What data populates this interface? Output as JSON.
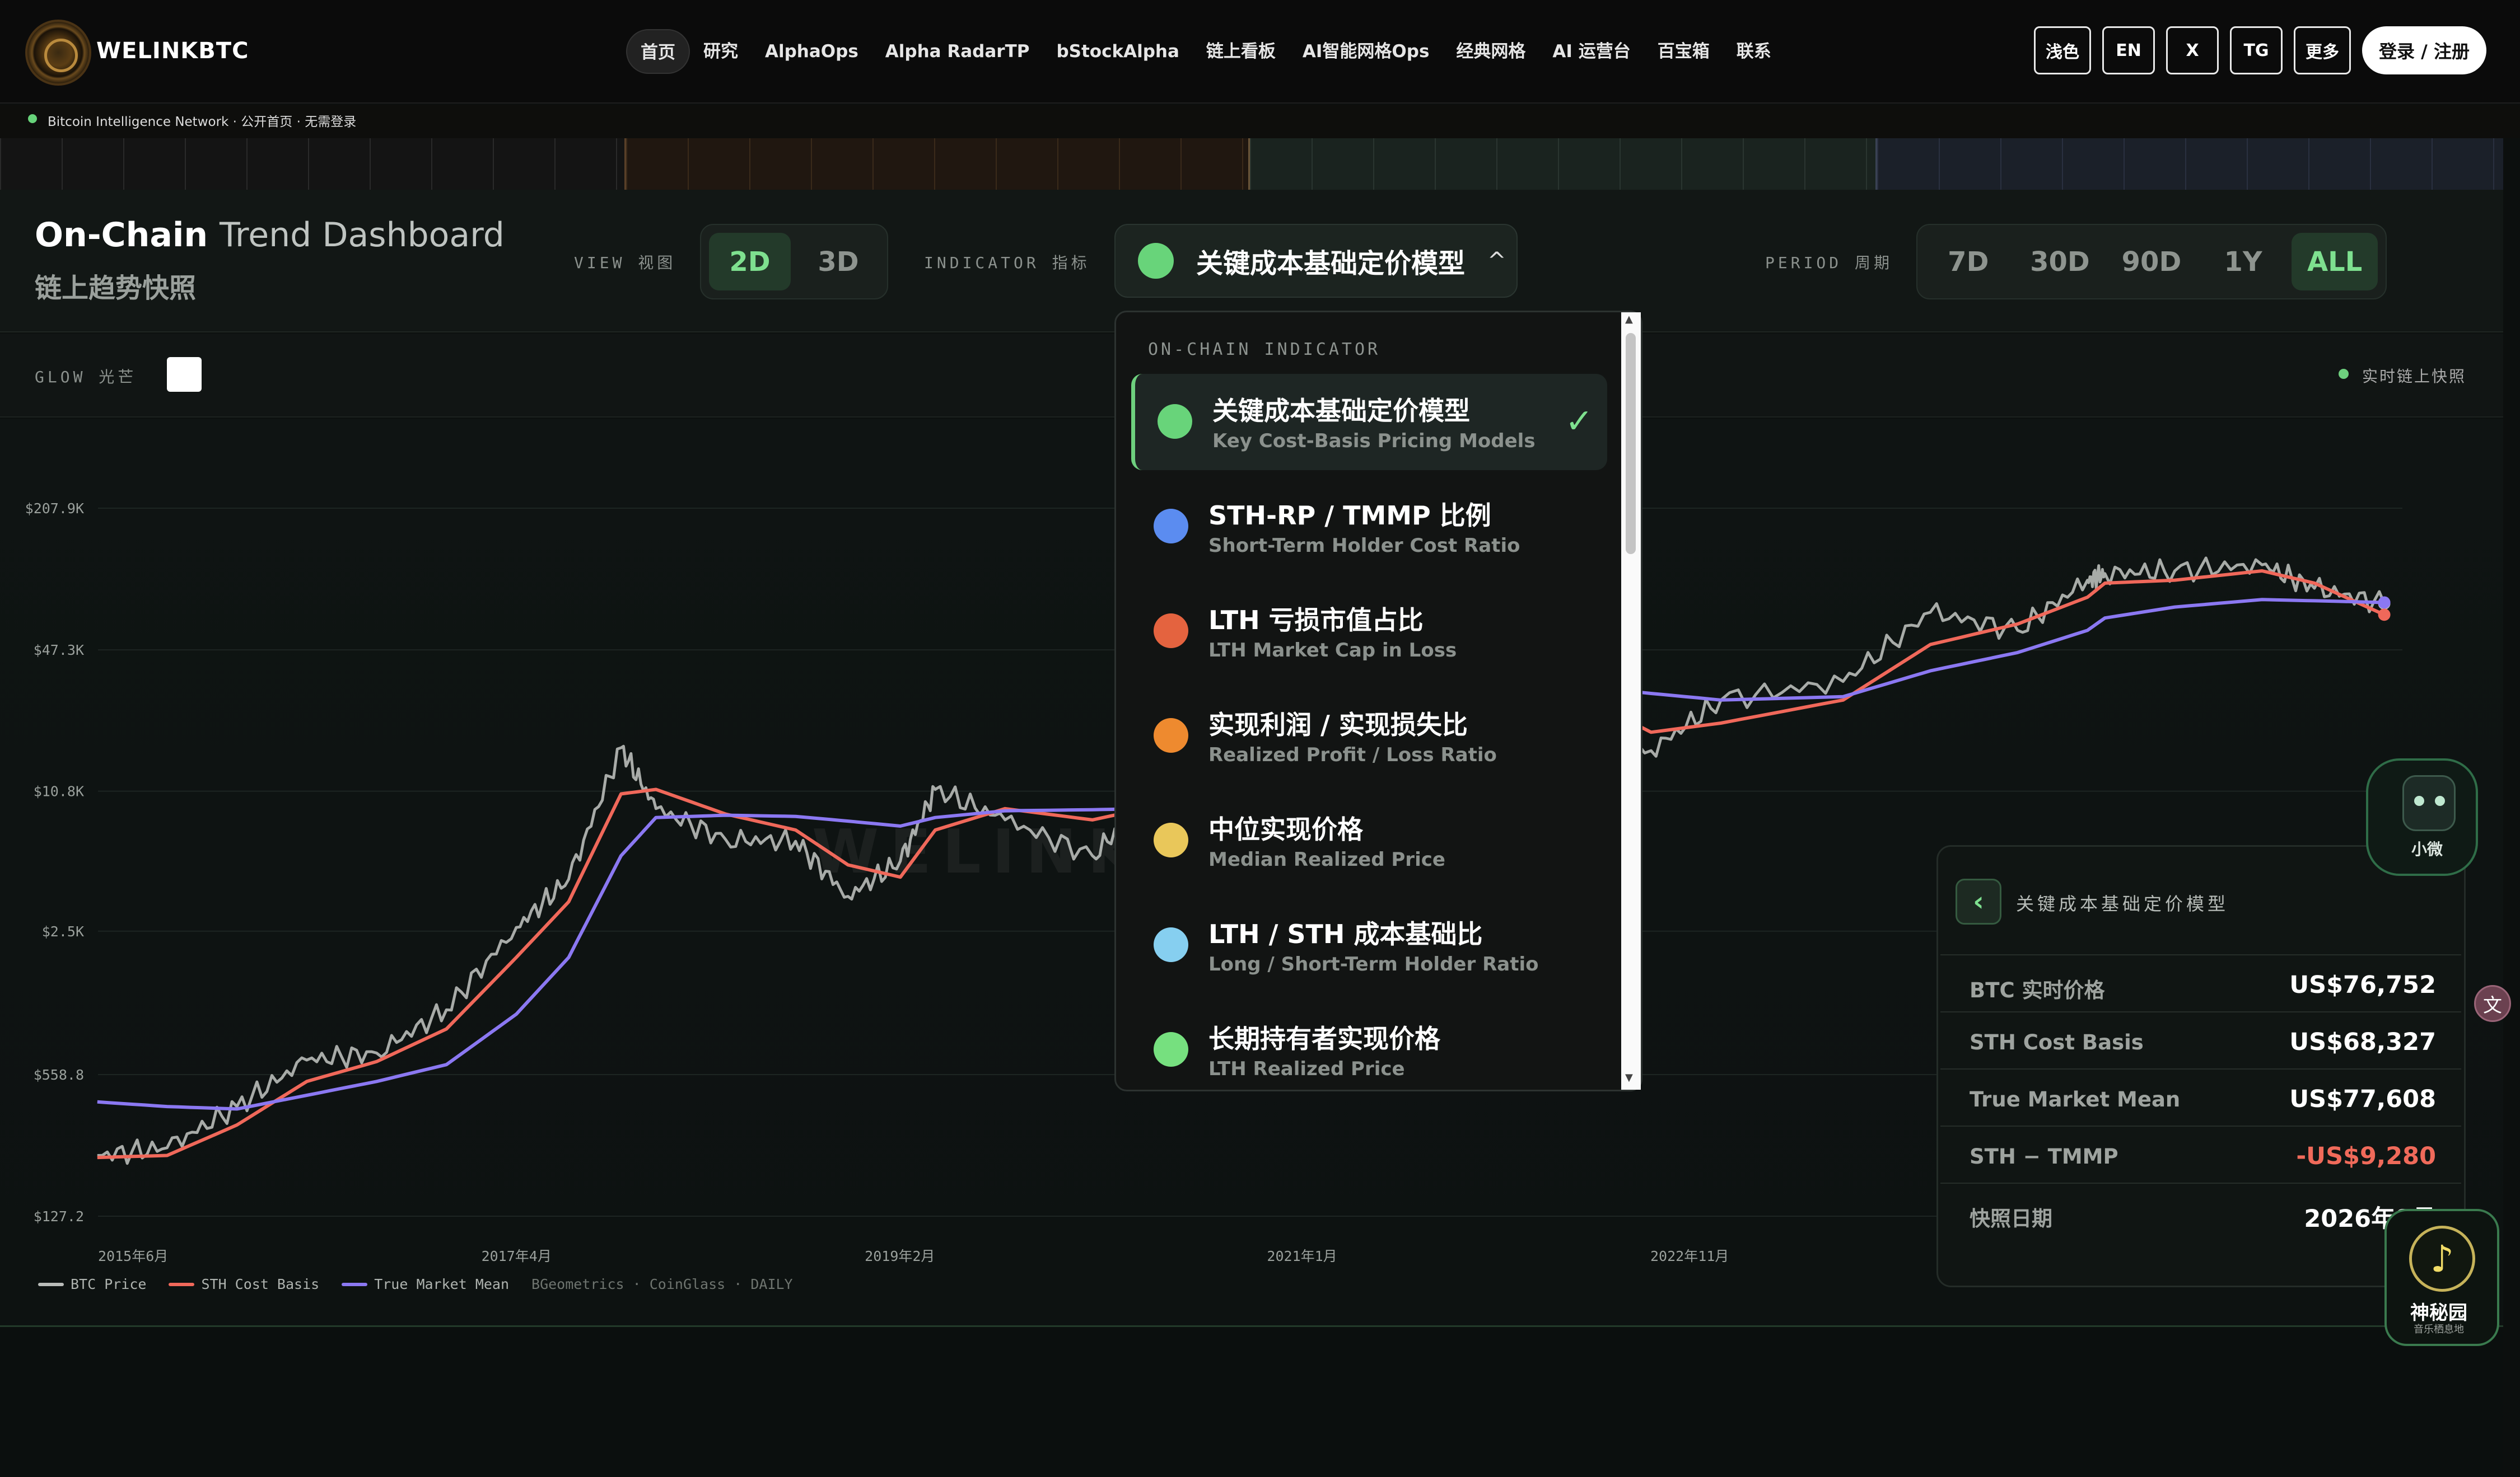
{
  "brand": {
    "name": "WELINKBTC"
  },
  "nav": {
    "links": [
      "首页",
      "研究",
      "AlphaOps",
      "Alpha RadarTP",
      "bStockAlpha",
      "链上看板",
      "AI智能网格Ops",
      "经典网格",
      "AI 运营台",
      "百宝箱",
      "联系"
    ],
    "active_index": 0,
    "right_buttons": [
      "浅色",
      "EN",
      "X",
      "TG",
      "更多"
    ],
    "login_label": "登录 / 注册"
  },
  "status": {
    "text": "Bitcoin Intelligence Network · 公开首页 · 无需登录",
    "dot_color": "#67d37a"
  },
  "dashboard": {
    "title_main": "On-Chain",
    "title_rest": "Trend Dashboard",
    "title_zh": "链上趋势快照",
    "view_label": "VIEW 视图",
    "view_options": [
      "2D",
      "3D"
    ],
    "view_selected": "2D",
    "indicator_label": "INDICATOR 指标",
    "indicator_selected": "关键成本基础定价模型",
    "indicator_caret": "^",
    "period_label": "PERIOD 周期",
    "period_options": [
      "7D",
      "30D",
      "90D",
      "1Y",
      "ALL"
    ],
    "period_selected": "ALL",
    "glow_label": "GLOW 光芒",
    "live_label": "实时链上快照"
  },
  "dropdown": {
    "header": "ON-CHAIN INDICATOR",
    "items": [
      {
        "zh": "关键成本基础定价模型",
        "en": "Key Cost-Basis Pricing Models",
        "color": "#68d47a",
        "selected": true
      },
      {
        "zh": "STH-RP / TMMP 比例",
        "en": "Short-Term Holder Cost Ratio",
        "color": "#5b8cf0"
      },
      {
        "zh": "LTH 亏损市值占比",
        "en": "LTH Market Cap in Loss",
        "color": "#e4633f"
      },
      {
        "zh": "实现利润 / 实现损失比",
        "en": "Realized Profit / Loss Ratio",
        "color": "#ee8a2f"
      },
      {
        "zh": "中位实现价格",
        "en": "Median Realized Price",
        "color": "#e9c75a"
      },
      {
        "zh": "LTH / STH 成本基础比",
        "en": "Long / Short-Term Holder Ratio",
        "color": "#86cff0"
      },
      {
        "zh": "长期持有者实现价格",
        "en": "LTH Realized Price",
        "color": "#76e07f"
      }
    ],
    "check": "✓"
  },
  "chart_data": {
    "type": "line",
    "y_scale": "log",
    "y_ticks": [
      "$207.9K",
      "$47.3K",
      "$10.8K",
      "$2.5K",
      "$558.8",
      "$127.2"
    ],
    "y_tick_values": [
      207900,
      47300,
      10800,
      2500,
      558.8,
      127.2
    ],
    "x_ticks": [
      "2015年6月",
      "2017年4月",
      "2019年2月",
      "2021年1月",
      "2022年11月"
    ],
    "series": [
      {
        "name": "BTC Price",
        "color": "#b9bcb9",
        "points": [
          [
            "2015-06",
            240
          ],
          [
            "2015-10",
            260
          ],
          [
            "2016-02",
            400
          ],
          [
            "2016-06",
            650
          ],
          [
            "2016-10",
            700
          ],
          [
            "2017-02",
            1100
          ],
          [
            "2017-06",
            2600
          ],
          [
            "2017-09",
            4300
          ],
          [
            "2017-12",
            17000
          ],
          [
            "2018-02",
            9000
          ],
          [
            "2018-06",
            6500
          ],
          [
            "2018-10",
            6400
          ],
          [
            "2019-01",
            3600
          ],
          [
            "2019-04",
            5200
          ],
          [
            "2019-06",
            11000
          ],
          [
            "2019-10",
            8000
          ],
          [
            "2020-03",
            5500
          ],
          [
            "2020-06",
            9500
          ],
          [
            "2020-10",
            12500
          ],
          [
            "2021-01",
            35000
          ],
          [
            "2021-04",
            58000
          ],
          [
            "2021-07",
            33000
          ],
          [
            "2021-11",
            66000
          ],
          [
            "2022-06",
            20000
          ],
          [
            "2022-11",
            16500
          ],
          [
            "2023-03",
            28000
          ],
          [
            "2023-10",
            34000
          ],
          [
            "2024-03",
            70000
          ],
          [
            "2024-08",
            58000
          ],
          [
            "2024-12",
            98000
          ],
          [
            "2025-01",
            105000
          ],
          [
            "2025-05",
            108000
          ],
          [
            "2025-10",
            115000
          ],
          [
            "2026-01",
            90000
          ],
          [
            "2026-05",
            76752
          ]
        ]
      },
      {
        "name": "STH Cost Basis",
        "color": "#f0685a",
        "points": [
          [
            "2015-06",
            235
          ],
          [
            "2015-10",
            240
          ],
          [
            "2016-02",
            330
          ],
          [
            "2016-06",
            520
          ],
          [
            "2016-10",
            640
          ],
          [
            "2017-02",
            900
          ],
          [
            "2017-06",
            1900
          ],
          [
            "2017-09",
            3400
          ],
          [
            "2017-12",
            10500
          ],
          [
            "2018-02",
            11000
          ],
          [
            "2018-06",
            8500
          ],
          [
            "2018-10",
            7200
          ],
          [
            "2019-01",
            5000
          ],
          [
            "2019-04",
            4400
          ],
          [
            "2019-06",
            7200
          ],
          [
            "2019-10",
            9000
          ],
          [
            "2020-03",
            8000
          ],
          [
            "2020-06",
            9000
          ],
          [
            "2020-10",
            10500
          ],
          [
            "2021-01",
            20000
          ],
          [
            "2021-04",
            45000
          ],
          [
            "2021-07",
            42000
          ],
          [
            "2021-11",
            55000
          ],
          [
            "2022-06",
            32000
          ],
          [
            "2022-11",
            20000
          ],
          [
            "2023-03",
            22000
          ],
          [
            "2023-10",
            28000
          ],
          [
            "2024-03",
            50000
          ],
          [
            "2024-08",
            62000
          ],
          [
            "2024-12",
            82000
          ],
          [
            "2025-01",
            95000
          ],
          [
            "2025-05",
            98000
          ],
          [
            "2025-10",
            108000
          ],
          [
            "2026-01",
            95000
          ],
          [
            "2026-05",
            68327
          ]
        ]
      },
      {
        "name": "True Market Mean",
        "color": "#8b78f2",
        "points": [
          [
            "2015-06",
            420
          ],
          [
            "2015-10",
            400
          ],
          [
            "2016-02",
            390
          ],
          [
            "2016-06",
            450
          ],
          [
            "2016-10",
            520
          ],
          [
            "2017-02",
            620
          ],
          [
            "2017-06",
            1050
          ],
          [
            "2017-09",
            1900
          ],
          [
            "2017-12",
            5500
          ],
          [
            "2018-02",
            8200
          ],
          [
            "2018-06",
            8400
          ],
          [
            "2018-10",
            8300
          ],
          [
            "2019-01",
            7900
          ],
          [
            "2019-04",
            7500
          ],
          [
            "2019-06",
            8200
          ],
          [
            "2019-10",
            8800
          ],
          [
            "2020-03",
            8900
          ],
          [
            "2020-06",
            9000
          ],
          [
            "2020-10",
            9400
          ],
          [
            "2021-01",
            13000
          ],
          [
            "2021-04",
            22000
          ],
          [
            "2021-07",
            26000
          ],
          [
            "2021-11",
            33000
          ],
          [
            "2022-06",
            33000
          ],
          [
            "2022-11",
            30000
          ],
          [
            "2023-03",
            28000
          ],
          [
            "2023-10",
            29000
          ],
          [
            "2024-03",
            38000
          ],
          [
            "2024-08",
            46000
          ],
          [
            "2024-12",
            58000
          ],
          [
            "2025-01",
            66000
          ],
          [
            "2025-05",
            74000
          ],
          [
            "2025-10",
            80000
          ],
          [
            "2026-01",
            79000
          ],
          [
            "2026-05",
            77608
          ]
        ]
      }
    ],
    "legend": [
      "BTC Price",
      "STH Cost Basis",
      "True Market Mean"
    ],
    "source": "BGeometrics · CoinGlass · DAILY",
    "grid": true,
    "legend_placement": "bottom-left"
  },
  "watermark": "WELINKCHAIN",
  "info_panel": {
    "title": "关键成本基础定价模型",
    "back_icon": "‹",
    "rows": [
      {
        "k": "BTC 实时价格",
        "v": "US$76,752"
      },
      {
        "k": "STH Cost Basis",
        "v": "US$68,327"
      },
      {
        "k": "True Market Mean",
        "v": "US$77,608"
      },
      {
        "k": "STH − TMMP",
        "v": "-US$9,280",
        "negative": true
      },
      {
        "k": "快照日期",
        "v": "2026年8月"
      }
    ]
  },
  "bots": {
    "bot1_name": "小微",
    "bot2_name": "神秘园",
    "bot2_sub": "音乐栖息地",
    "bot2_icon": "music-note-icon",
    "translate_icon": "translate-icon"
  }
}
